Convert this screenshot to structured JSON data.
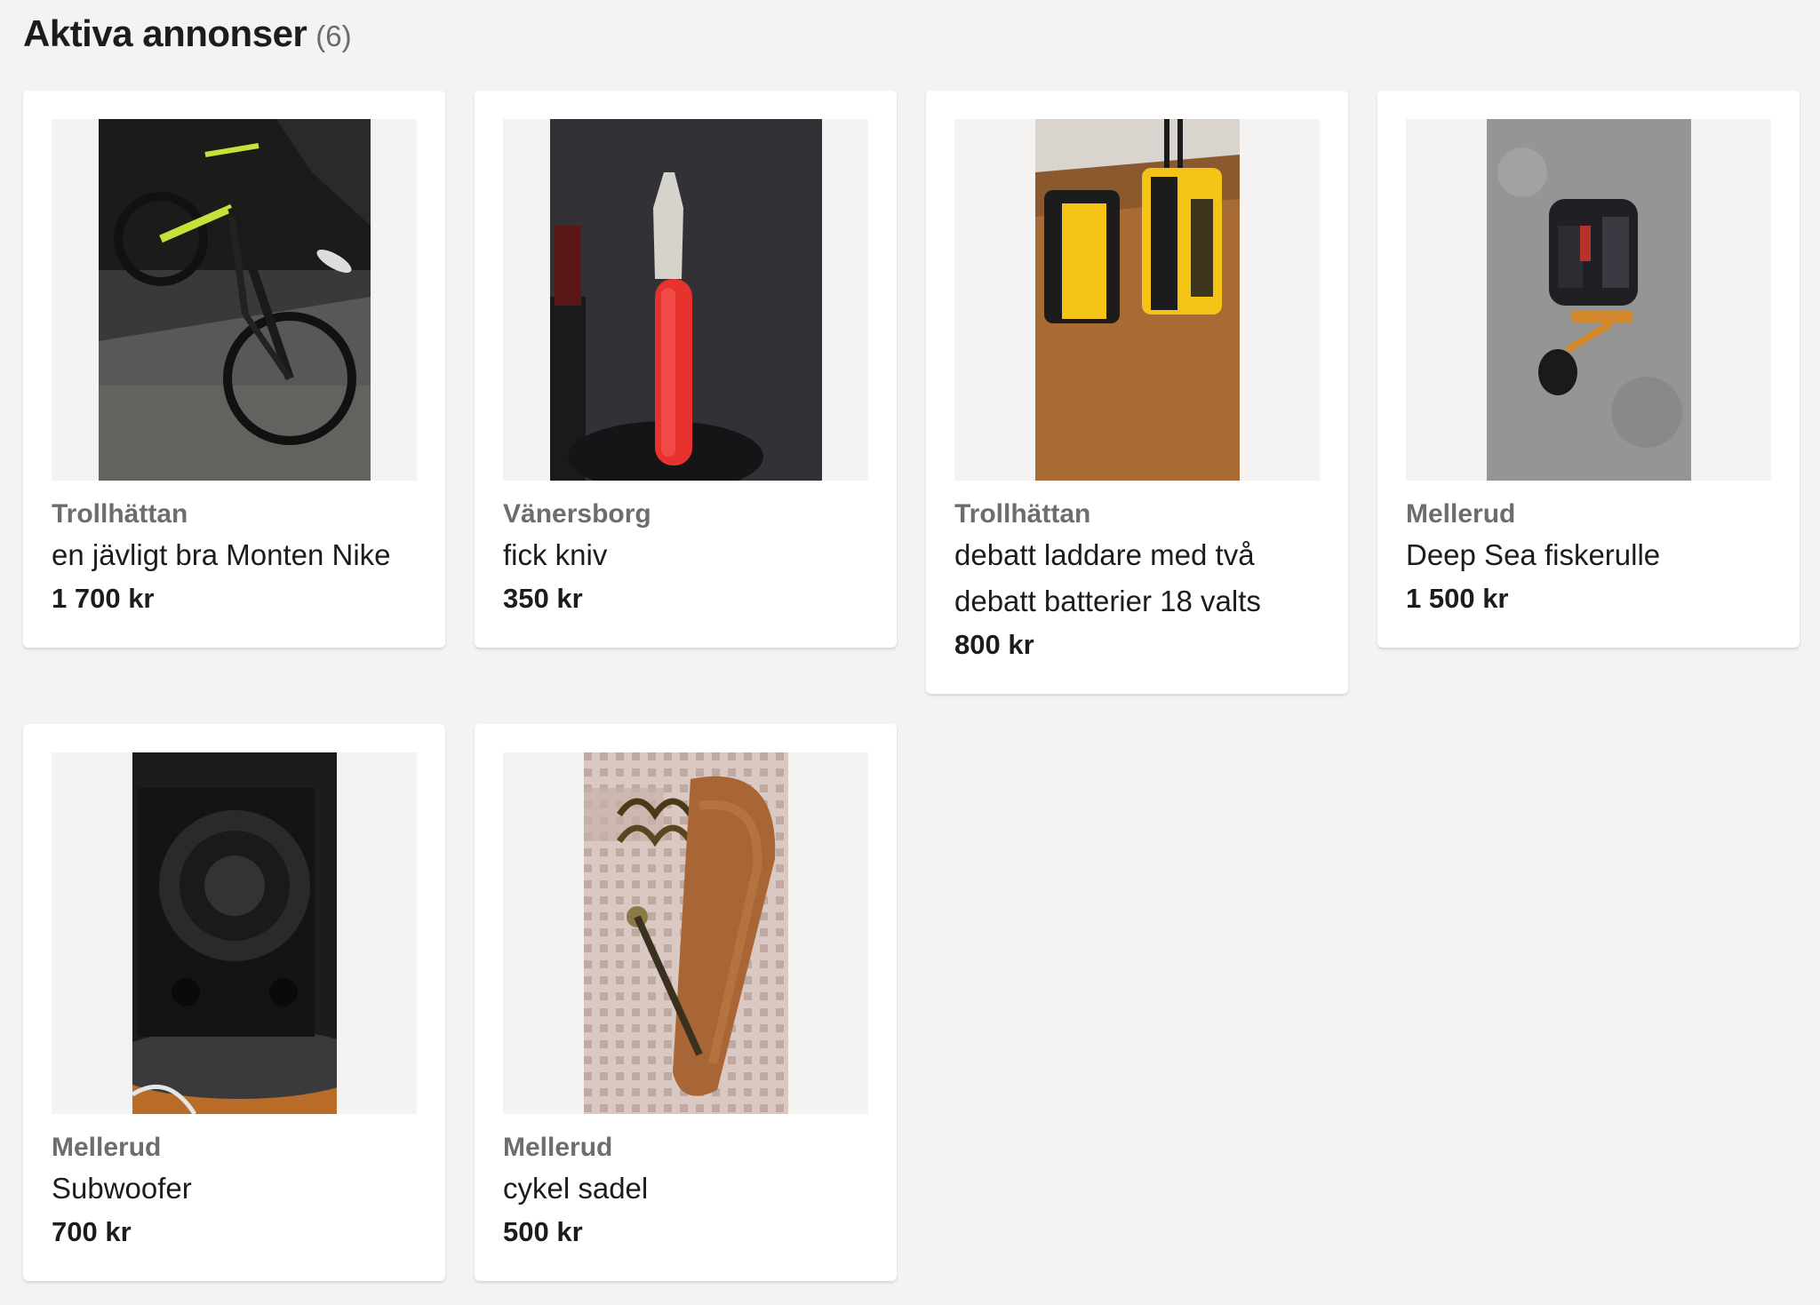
{
  "heading": {
    "title": "Aktiva annonser",
    "count": "(6)"
  },
  "listings": [
    {
      "location": "Trollhättan",
      "title": "en jävligt bra Monten Nike",
      "price": "1 700 kr",
      "image": "bicycle-photo"
    },
    {
      "location": "Vänersborg",
      "title": "fick kniv",
      "price": "350 kr",
      "image": "knife-photo"
    },
    {
      "location": "Trollhättan",
      "title": "debatt laddare med två debatt batterier 18 valts",
      "price": "800 kr",
      "image": "battery-photo"
    },
    {
      "location": "Mellerud",
      "title": "Deep Sea fiskerulle",
      "price": "1 500 kr",
      "image": "fishing-reel-photo"
    },
    {
      "location": "Mellerud",
      "title": "Subwoofer",
      "price": "700 kr",
      "image": "subwoofer-photo"
    },
    {
      "location": "Mellerud",
      "title": "cykel sadel",
      "price": "500 kr",
      "image": "bike-saddle-photo"
    }
  ]
}
